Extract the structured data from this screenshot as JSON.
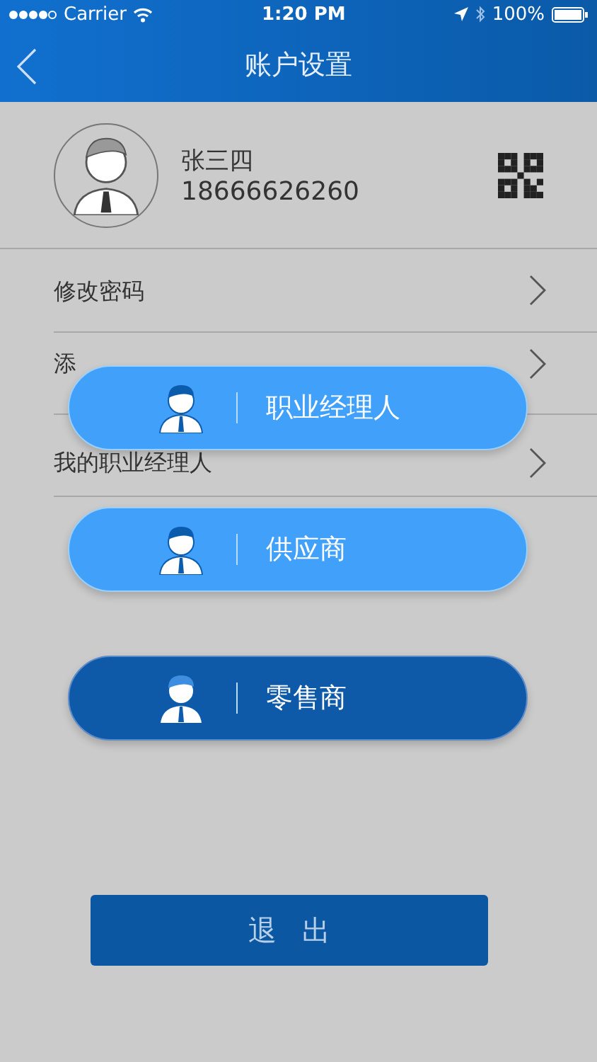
{
  "status_bar": {
    "carrier": "Carrier",
    "time": "1:20 PM",
    "battery": "100%"
  },
  "nav": {
    "title": "账户设置"
  },
  "profile": {
    "name": "张三四",
    "phone": "18666626260"
  },
  "menu": [
    {
      "label": "修改密码"
    },
    {
      "label": "添"
    },
    {
      "label": "我的职业经理人"
    }
  ],
  "roles": [
    {
      "label": "职业经理人",
      "selected": false
    },
    {
      "label": "供应商",
      "selected": false
    },
    {
      "label": "零售商",
      "selected": true
    }
  ],
  "logout": "退 出"
}
